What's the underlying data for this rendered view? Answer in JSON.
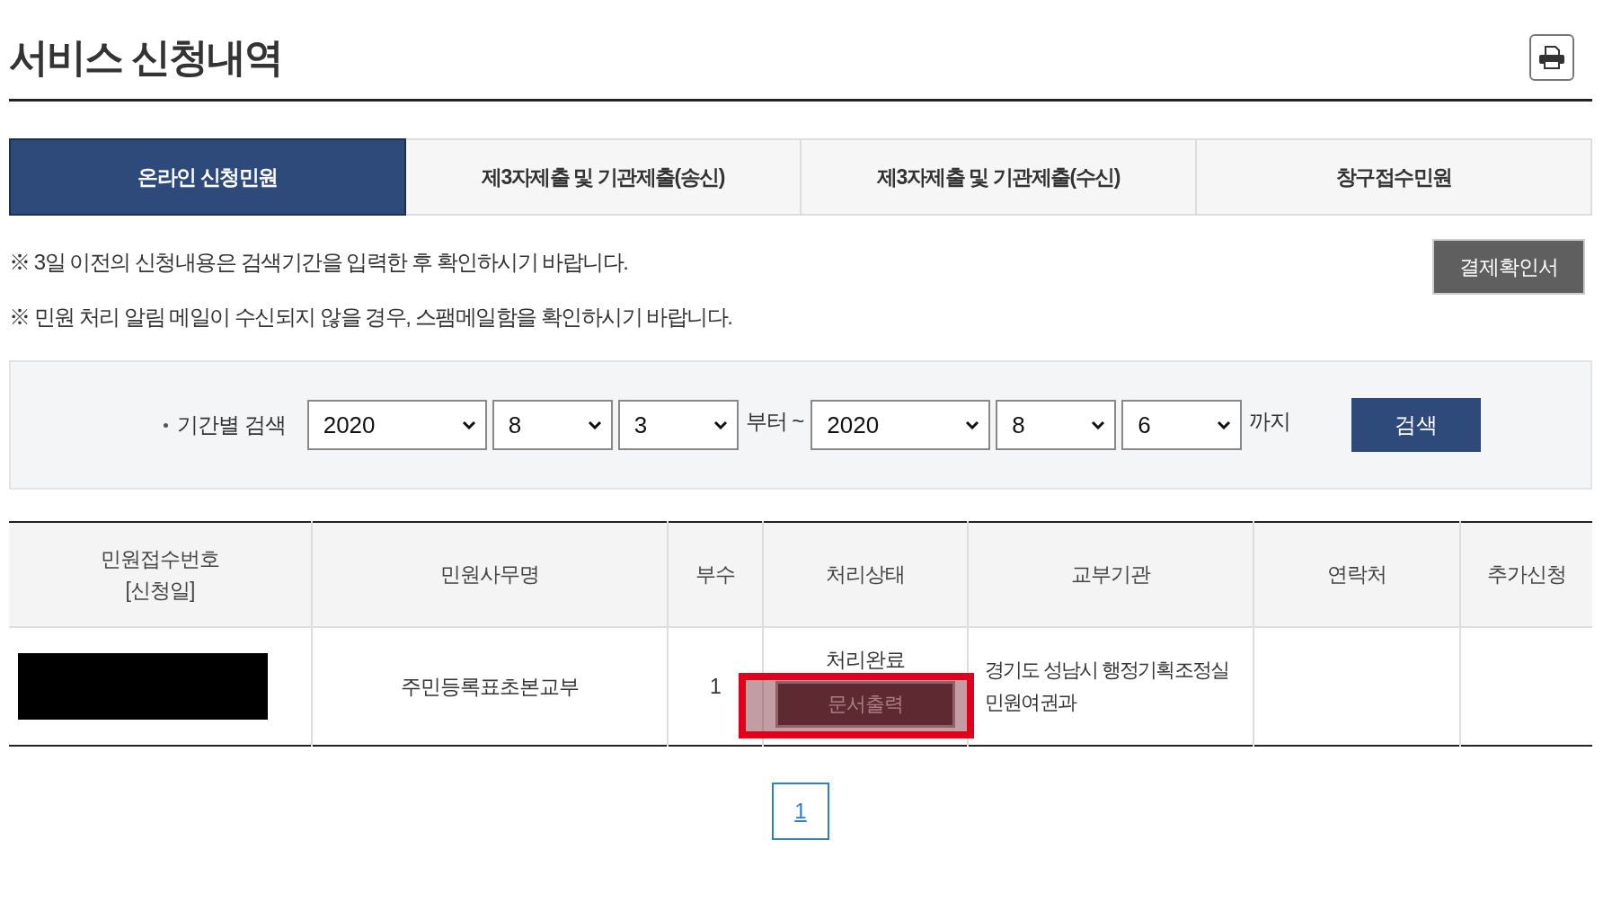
{
  "page_title": "서비스 신청내역",
  "tabs": [
    {
      "label": "온라인 신청민원",
      "selected": true
    },
    {
      "label": "제3자제출 및 기관제출(송신)",
      "selected": false
    },
    {
      "label": "제3자제출 및 기관제출(수신)",
      "selected": false
    },
    {
      "label": "창구접수민원",
      "selected": false
    }
  ],
  "notices": [
    "※ 3일 이전의 신청내용은 검색기간을 입력한 후 확인하시기 바랍니다.",
    "※ 민원 처리 알림 메일이 수신되지 않을 경우, 스팸메일함을 확인하시기 바랍니다."
  ],
  "payment_button": "결제확인서",
  "search": {
    "label": "기간별 검색",
    "from": [
      "2020",
      "8",
      "3"
    ],
    "from_suffix": "부터 ~",
    "to": [
      "2020",
      "8",
      "6"
    ],
    "to_suffix": "까지",
    "button": "검색"
  },
  "table": {
    "columns": [
      "민원접수번호\n[신청일]",
      "민원사무명",
      "부수",
      "처리상태",
      "교부기관",
      "연락처",
      "추가신청"
    ],
    "rows": [
      {
        "receipt_redacted": true,
        "name": "주민등록표초본교부",
        "copies": "1",
        "status": "처리완료",
        "status_button": "문서출력",
        "highlighted": true,
        "agency": "경기도 성남시 행정기획조정실 민원여권과"
      }
    ]
  },
  "pagination": [
    {
      "label": "1",
      "selected": true
    }
  ]
}
